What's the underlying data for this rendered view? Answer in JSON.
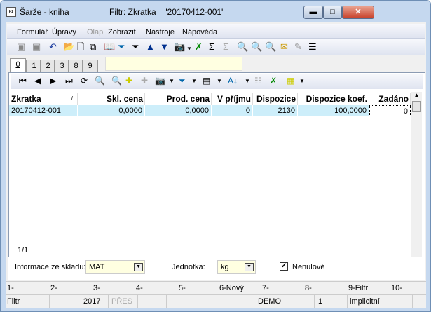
{
  "window": {
    "title": "Šarže - kniha",
    "filter_text": "Filtr: Zkratka = '20170412-001'",
    "app_icon": "K2"
  },
  "menu": [
    "Formulář",
    "Úpravy",
    "Olap",
    "Zobrazit",
    "Nástroje",
    "Nápověda"
  ],
  "tabs": [
    "0",
    "1",
    "2",
    "3",
    "8",
    "9"
  ],
  "grid": {
    "columns": [
      "Zkratka",
      "Skl. cena",
      "Prod. cena",
      "V příjmu",
      "Dispozice",
      "Dispozice koef.",
      "Zadáno"
    ],
    "rows": [
      [
        "20170412-001",
        "0,0000",
        "0,0000",
        "0",
        "2130",
        "100,0000",
        "0"
      ]
    ]
  },
  "record_count": "1/1",
  "filters": {
    "store_label": "Informace ze skladu:",
    "store_value": "MAT",
    "unit_label": "Jednotka:",
    "unit_value": "kg",
    "nonzero_label": "Nenulové",
    "nonzero_checked": true
  },
  "fkeys": [
    "1-",
    "2-",
    "3-",
    "4-",
    "5-",
    "6-Nový",
    "7-",
    "8-",
    "9-Filtr",
    "10-"
  ],
  "status": [
    "Filtr",
    "",
    "2017",
    "PŘES",
    "",
    "",
    "",
    "DEMO",
    "1",
    "implicitní"
  ]
}
